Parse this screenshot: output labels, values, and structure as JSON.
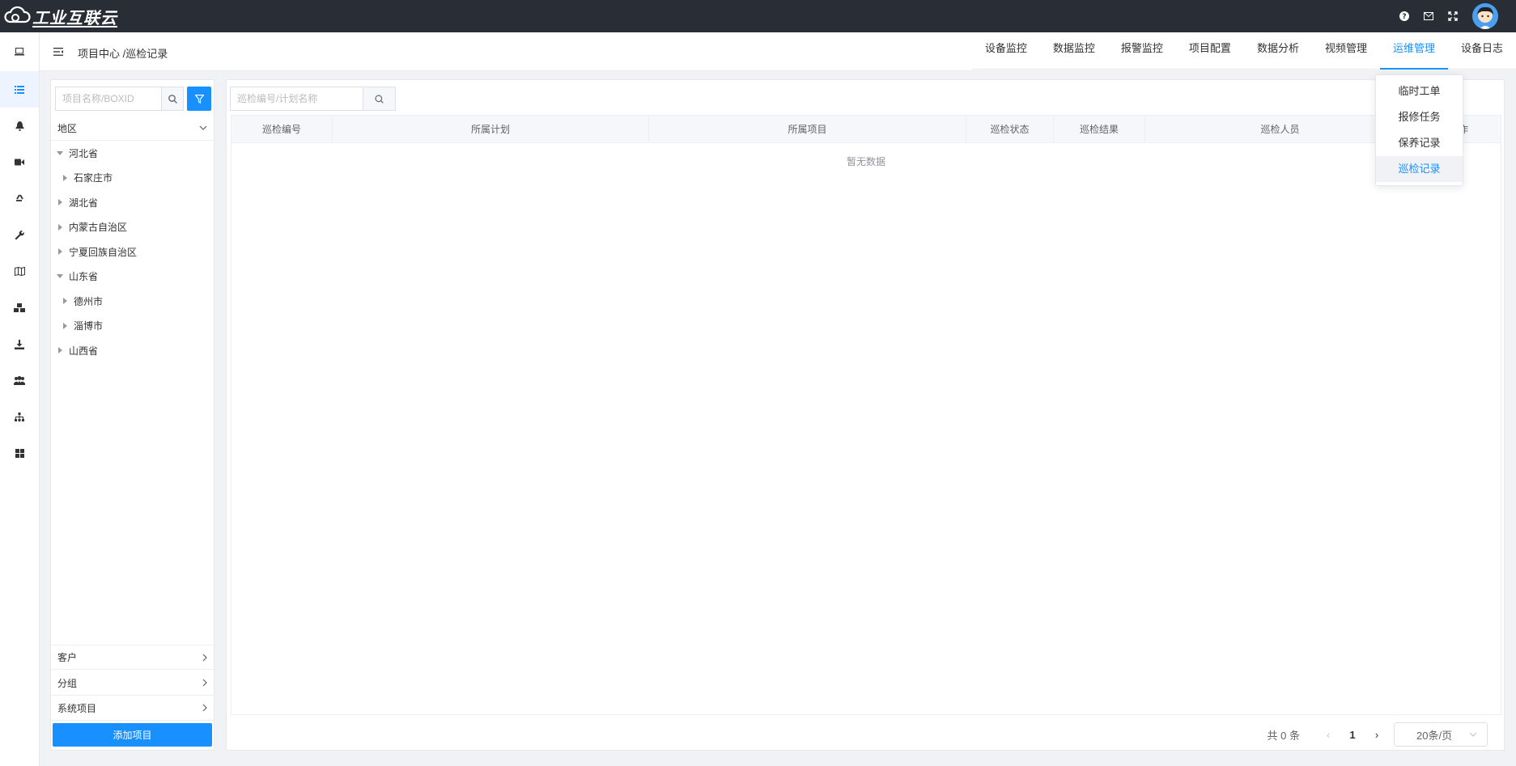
{
  "app": {
    "logo_text": "工业互联云"
  },
  "header": {
    "breadcrumb": "项目中心 /巡检记录",
    "nav": [
      {
        "label": "设备监控"
      },
      {
        "label": "数据监控"
      },
      {
        "label": "报警监控"
      },
      {
        "label": "项目配置"
      },
      {
        "label": "数据分析"
      },
      {
        "label": "视频管理"
      },
      {
        "label": "运维管理",
        "active": true
      },
      {
        "label": "设备日志"
      }
    ]
  },
  "dropdown": {
    "items": [
      "临时工单",
      "报修任务",
      "保养记录",
      "巡检记录"
    ],
    "active": "巡检记录"
  },
  "sidebar": {
    "search_placeholder": "项目名称/BOXID",
    "region_label": "地区",
    "tree": [
      {
        "label": "河北省",
        "level": 0,
        "expanded": true
      },
      {
        "label": "石家庄市",
        "level": 1,
        "expanded": false
      },
      {
        "label": "湖北省",
        "level": 0,
        "expanded": false
      },
      {
        "label": "内蒙古自治区",
        "level": 0,
        "expanded": false
      },
      {
        "label": "宁夏回族自治区",
        "level": 0,
        "expanded": false
      },
      {
        "label": "山东省",
        "level": 0,
        "expanded": true
      },
      {
        "label": "德州市",
        "level": 1,
        "expanded": false
      },
      {
        "label": "淄博市",
        "level": 1,
        "expanded": false
      },
      {
        "label": "山西省",
        "level": 0,
        "expanded": false
      }
    ],
    "sections": [
      "客户",
      "分组",
      "系统项目"
    ],
    "add_button": "添加项目"
  },
  "main": {
    "search_placeholder": "巡检编号/计划名称",
    "columns": [
      "巡检编号",
      "所属计划",
      "所属项目",
      "巡检状态",
      "巡检结果",
      "巡检人员",
      "作"
    ],
    "empty_text": "暂无数据",
    "pagination": {
      "total": "共 0 条",
      "page": "1",
      "page_size": "20条/页"
    }
  },
  "colors": {
    "primary": "#1890ff",
    "topbar": "#282d36"
  }
}
